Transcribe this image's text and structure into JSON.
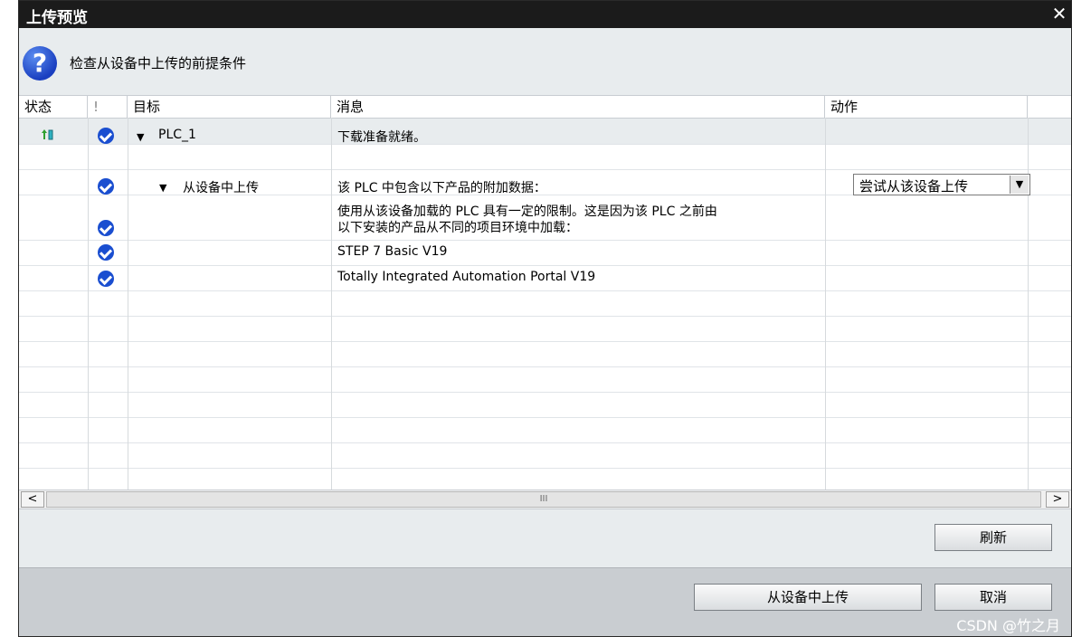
{
  "window": {
    "title": "上传预览",
    "close_glyph": "✕"
  },
  "header": {
    "icon": "question-icon",
    "icon_glyph": "?",
    "text": "检查从设备中上传的前提条件"
  },
  "columns": {
    "status": "状态",
    "alert": "!",
    "target": "目标",
    "message": "消息",
    "action": "动作"
  },
  "rows": [
    {
      "target": "PLC_1",
      "message": "下载准备就绪。",
      "has_check": true,
      "has_status_icon": true,
      "expanded": true
    },
    {
      "target": "从设备中上传",
      "message": "该 PLC 中包含以下产品的附加数据：",
      "has_check": true,
      "expanded": true,
      "action_dropdown": "尝试从该设备上传"
    },
    {
      "message_line1": "使用从该设备加载的 PLC 具有一定的限制。这是因为该 PLC 之前由",
      "message_line2": "以下安装的产品从不同的项目环境中加载：",
      "has_check": true
    },
    {
      "message": "STEP 7 Basic V19",
      "has_check": true
    },
    {
      "message": "Totally Integrated Automation Portal V19",
      "has_check": true
    }
  ],
  "buttons": {
    "refresh": "刷新",
    "upload": "从设备中上传",
    "cancel": "取消"
  },
  "scrollbar": {
    "left_glyph": "<",
    "right_glyph": ">",
    "thumb_glyph": "III"
  },
  "watermark": "CSDN @竹之月",
  "colors": {
    "check": "#1a4ed0",
    "titlebar": "#1b1b1b",
    "status_arrow": "#2fa02f"
  }
}
